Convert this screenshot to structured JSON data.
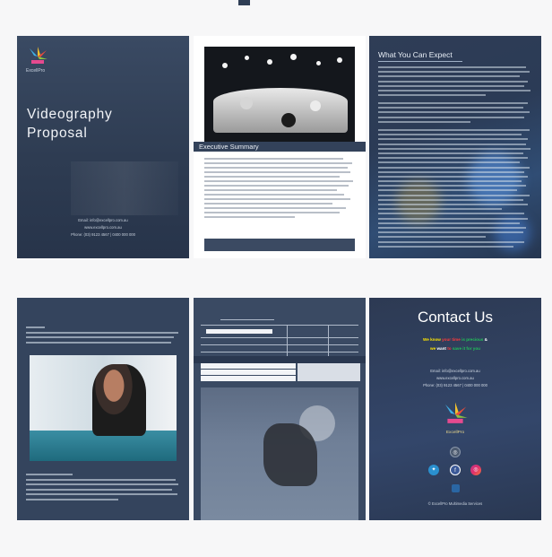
{
  "page1": {
    "logo_text": "ExcellPro",
    "title_line1": "Videography",
    "title_line2": "Proposal",
    "contact": [
      "Email: info@excellpro.com.au",
      "www.excellpro.com.au",
      "Phone: (03) 9123 4567 | 0400 000 000"
    ]
  },
  "page2": {
    "section_title": "Executive Summary"
  },
  "page3": {
    "section_title": "What You Can Expect"
  },
  "page6": {
    "title": "Contact Us",
    "colored_text_line1": [
      "We know",
      "your time",
      "is precious",
      "&"
    ],
    "colored_text_line2": [
      "we",
      "want",
      "to",
      "save it for you"
    ],
    "colors": {
      "yellow": "#ffe600",
      "red": "#ff3a3a",
      "green": "#21c25a",
      "white": "#ffffff"
    },
    "contact": [
      "Email: info@excellpro.com.au",
      "www.excellpro.com.au",
      "Phone: (03) 9123 4567 | 0400 000 000"
    ],
    "logo_text": "ExcellPro",
    "footer": "© ExcellPro Multimedia Services",
    "icons": [
      "instagram-icon",
      "twitter-icon",
      "facebook-icon",
      "instagram-icon",
      "linkedin-icon"
    ]
  }
}
